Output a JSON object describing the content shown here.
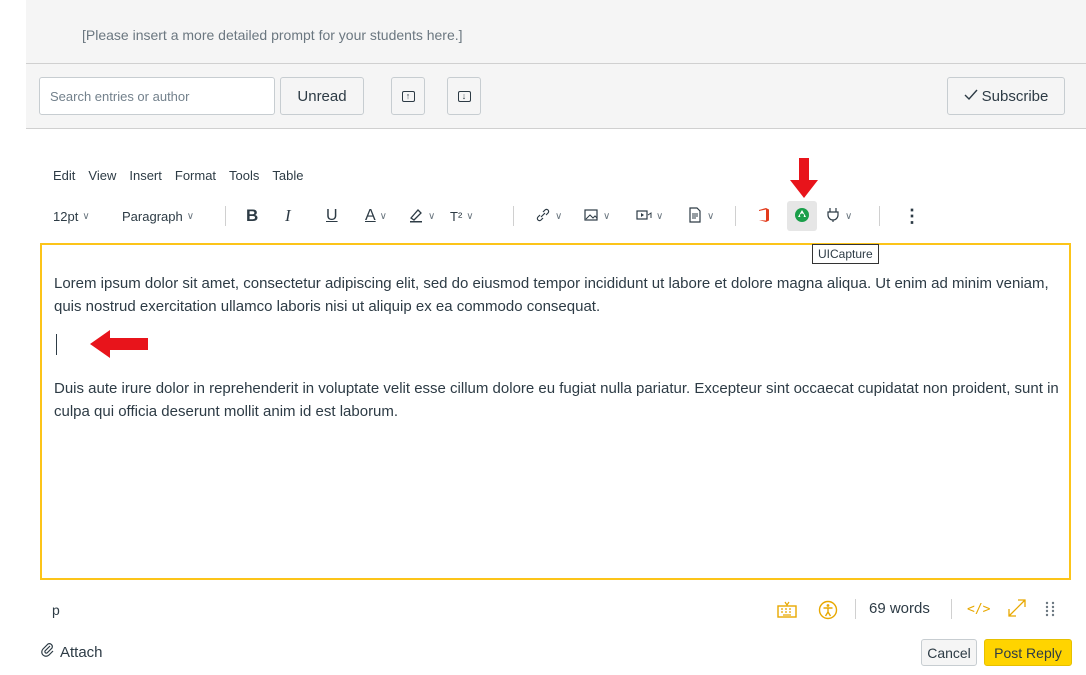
{
  "prompt": {
    "text": "[Please insert a more detailed prompt for your students here.]"
  },
  "toolbar": {
    "search_placeholder": "Search entries or author",
    "unread_label": "Unread",
    "subscribe_label": "Subscribe"
  },
  "menubar": {
    "items": [
      "Edit",
      "View",
      "Insert",
      "Format",
      "Tools",
      "Table"
    ]
  },
  "format_toolbar": {
    "font_size": "12pt",
    "block_format": "Paragraph",
    "bold_label": "B",
    "italic_label": "I",
    "underline_label": "U",
    "text_color_label": "A",
    "superscript_label": "T²",
    "more_label": "⋮"
  },
  "tooltip": {
    "text": "UICapture"
  },
  "editor": {
    "paragraph1": "Lorem ipsum dolor sit amet, consectetur adipiscing elit, sed do eiusmod tempor incididunt ut labore et dolore magna aliqua. Ut enim ad minim veniam, quis nostrud exercitation ullamco laboris nisi ut aliquip ex ea commodo consequat.",
    "paragraph2": "Duis aute irure dolor in reprehenderit in voluptate velit esse cillum dolore eu fugiat nulla pariatur. Excepteur sint occaecat cupidatat non proident, sunt in culpa qui officia deserunt mollit anim id est laborum."
  },
  "statusbar": {
    "path": "p",
    "word_count": "69 words"
  },
  "footer": {
    "attach_label": "Attach",
    "cancel_label": "Cancel",
    "post_label": "Post Reply"
  },
  "colors": {
    "editor_border": "#fcc419",
    "post_button": "#ffd400",
    "annotation_arrow": "#e8141b",
    "office_icon": "#e23b1c",
    "accessibility_icon": "#e8a800"
  },
  "icons": [
    "arrow-up-box-icon",
    "arrow-down-box-icon",
    "checkmark-icon",
    "highlighter-icon",
    "link-icon",
    "image-icon",
    "media-icon",
    "document-icon",
    "office-icon",
    "uicapture-icon",
    "plug-icon",
    "keyboard-icon",
    "accessibility-icon",
    "html-editor-icon",
    "fullscreen-icon",
    "resize-grip-icon",
    "paperclip-icon"
  ]
}
